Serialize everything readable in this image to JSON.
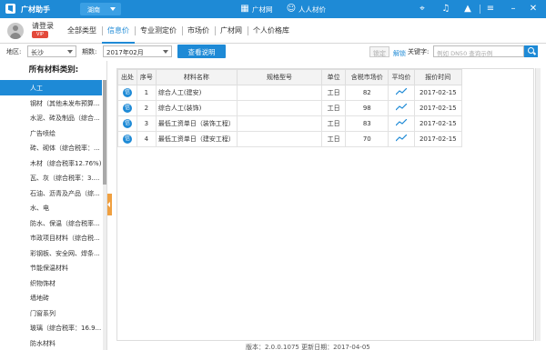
{
  "titlebar": {
    "app_name": "广材助手",
    "region": "湖南",
    "links": [
      "广材网",
      "人人材价"
    ],
    "icons": [
      "target-icon",
      "bell-icon",
      "shirt-icon",
      "menu-icon",
      "minimize-icon",
      "close-icon"
    ],
    "color": "#1e8ad6"
  },
  "user": {
    "login_label": "请登录",
    "vip_label": "VIP"
  },
  "nav": {
    "tabs": [
      "全部类型",
      "信息价",
      "专业测定价",
      "市场价",
      "广材网",
      "个人价格库"
    ],
    "active": "信息价"
  },
  "filters": {
    "region_label": "地区:",
    "region_value": "长沙",
    "period_label": "期数:",
    "period_value": "2017年02月",
    "help_button": "查看说明",
    "lock_button": "锁定",
    "unlock_button": "解锁",
    "keyword_label": "关键字:",
    "search_placeholder": "例如 DN50 查询示例"
  },
  "sidebar": {
    "title": "所有材料类别:",
    "items": [
      "人工",
      "钢材（其他未发布预算...",
      "水泥、砖及制品（综合...",
      "广告喷绘",
      "砖、砌体（综合税率：...",
      "木材（综合税率12.76%)",
      "瓦、灰（综合税率：3....",
      "石油、沥青及产品（综...",
      "水、电",
      "防水、保温（综合税率...",
      "市政项目材料（综合税...",
      "彩钢板、安全网、焊条...",
      "节能保温材料",
      "织物饰材",
      "墙地砖",
      "门窗系列",
      "玻璃（综合税率：16.9...",
      "防水材料"
    ],
    "active_index": 0
  },
  "table": {
    "headers": [
      "出处",
      "序号",
      "材料名称",
      "规格型号",
      "单位",
      "含税市场价",
      "平均价",
      "报价时间"
    ],
    "rows": [
      {
        "source": "信",
        "no": "1",
        "name": "综合人工(建安)",
        "spec": "",
        "unit": "工日",
        "price": "82",
        "date": "2017-02-15"
      },
      {
        "source": "信",
        "no": "2",
        "name": "综合人工(装饰)",
        "spec": "",
        "unit": "工日",
        "price": "98",
        "date": "2017-02-15"
      },
      {
        "source": "信",
        "no": "3",
        "name": "最低工资单日（装饰工程）",
        "spec": "",
        "unit": "工日",
        "price": "83",
        "date": "2017-02-15"
      },
      {
        "source": "信",
        "no": "4",
        "name": "最低工资单日（建安工程）",
        "spec": "",
        "unit": "工日",
        "price": "70",
        "date": "2017-02-15"
      }
    ]
  },
  "footer": {
    "text": "版本：2.0.0.1075      更新日期：2017-04-05"
  }
}
